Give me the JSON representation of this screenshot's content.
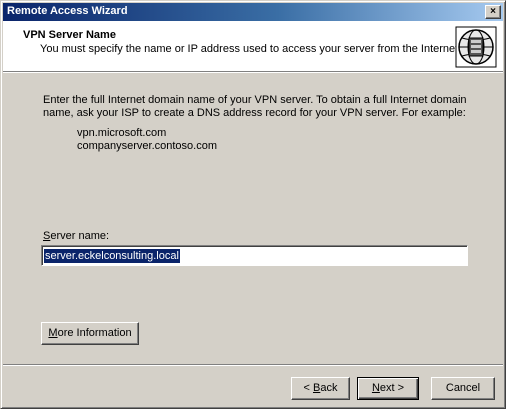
{
  "window": {
    "title": "Remote Access Wizard",
    "close_label": "×"
  },
  "header": {
    "title": "VPN Server Name",
    "subtitle": "You must specify the name or IP address used to access your server from the Internet.",
    "icon": "globe-server-icon"
  },
  "body": {
    "instruction": "Enter the full Internet domain name of your VPN server. To obtain a full Internet domain name, ask your ISP to create a DNS address record for your VPN server. For example:",
    "examples": [
      "vpn.microsoft.com",
      "companyserver.contoso.com"
    ]
  },
  "server_name": {
    "label_accel": "S",
    "label_rest": "erver name:",
    "value": "server.eckelconsulting.local"
  },
  "buttons": {
    "more_info_accel": "M",
    "more_info_rest": "ore Information",
    "back_prefix": "< ",
    "back_accel": "B",
    "back_rest": "ack",
    "next_accel": "N",
    "next_rest": "ext >",
    "cancel": "Cancel"
  }
}
